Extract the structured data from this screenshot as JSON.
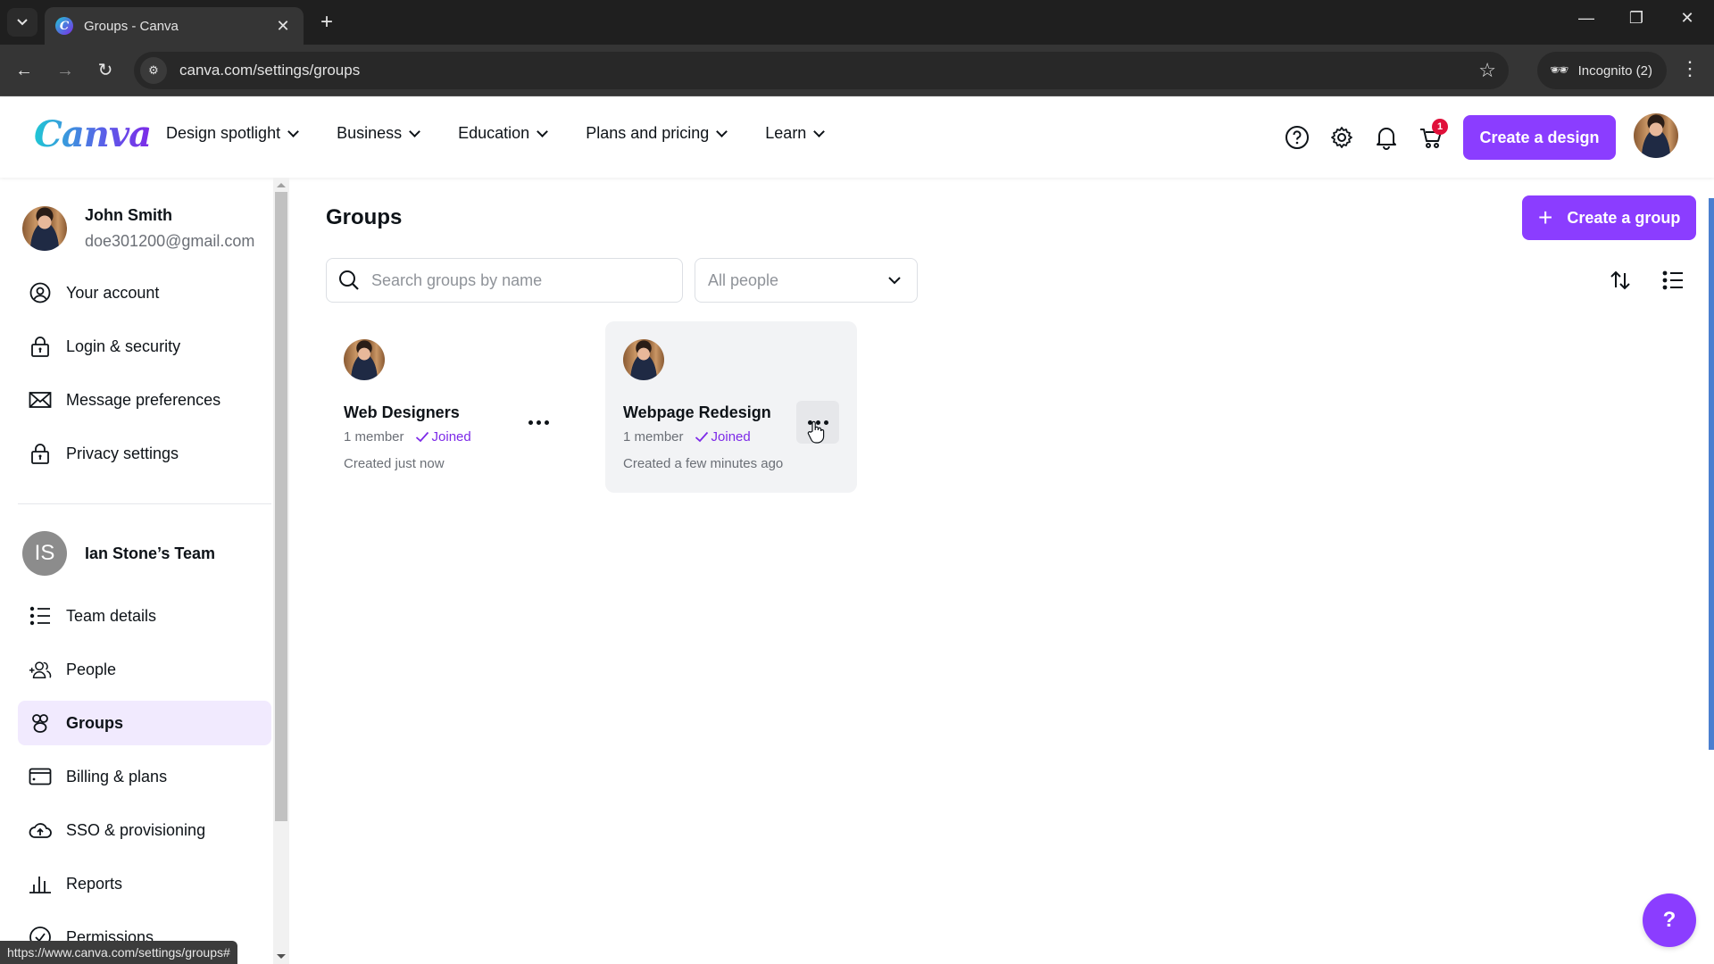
{
  "browser": {
    "tab_title": "Groups - Canva",
    "url": "canva.com/settings/groups",
    "incognito_label": "Incognito (2)",
    "status_url": "https://www.canva.com/settings/groups#"
  },
  "header": {
    "logo": "Canva",
    "nav": [
      {
        "label": "Design spotlight"
      },
      {
        "label": "Business"
      },
      {
        "label": "Education"
      },
      {
        "label": "Plans and pricing"
      },
      {
        "label": "Learn"
      }
    ],
    "cart_count": "1",
    "create_design_label": "Create a design"
  },
  "sidebar": {
    "user": {
      "name": "John Smith",
      "email": "doe301200@gmail.com"
    },
    "account_items": [
      {
        "label": "Your account",
        "icon": "user-circle-icon"
      },
      {
        "label": "Login & security",
        "icon": "lock-icon"
      },
      {
        "label": "Message preferences",
        "icon": "envelope-icon"
      },
      {
        "label": "Privacy settings",
        "icon": "lock-icon"
      }
    ],
    "team": {
      "initials": "IS",
      "name": "Ian Stone’s Team"
    },
    "team_items": [
      {
        "label": "Team details",
        "icon": "list-icon"
      },
      {
        "label": "People",
        "icon": "add-people-icon"
      },
      {
        "label": "Groups",
        "icon": "groups-icon",
        "active": true
      },
      {
        "label": "Billing & plans",
        "icon": "credit-card-icon"
      },
      {
        "label": "SSO & provisioning",
        "icon": "cloud-lock-icon"
      },
      {
        "label": "Reports",
        "icon": "bar-chart-icon"
      },
      {
        "label": "Permissions",
        "icon": "check-circle-icon"
      }
    ]
  },
  "main": {
    "title": "Groups",
    "create_group_label": "Create a group",
    "search_placeholder": "Search groups by name",
    "filter_value": "All people",
    "groups": [
      {
        "name": "Web Designers",
        "members": "1 member",
        "status": "Joined",
        "created": "Created just now"
      },
      {
        "name": "Webpage Redesign",
        "members": "1 member",
        "status": "Joined",
        "created": "Created a few minutes ago"
      }
    ],
    "help_label": "?"
  }
}
